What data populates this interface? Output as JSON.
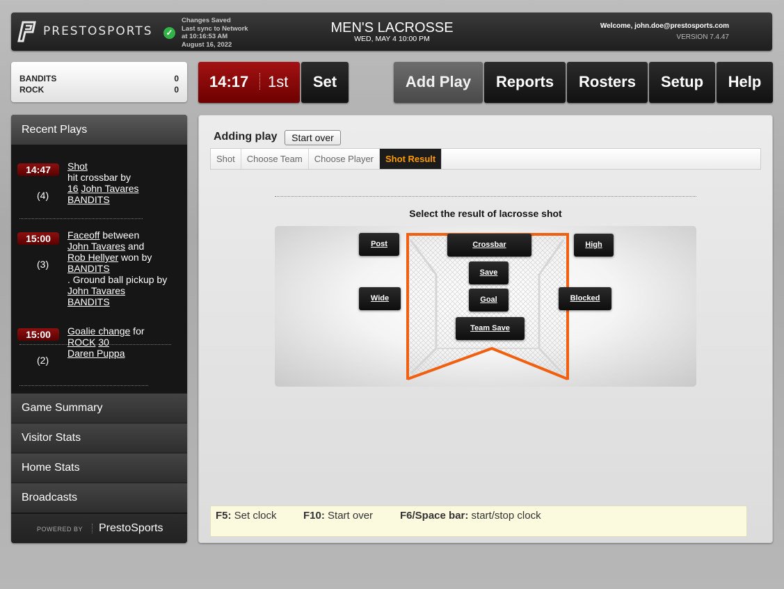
{
  "header": {
    "logo_text": "PRESTOSPORTS",
    "sync": {
      "line1": "Changes Saved",
      "line2": "Last sync to Network",
      "line3": "at 10:16:53 AM",
      "line4": "August 16, 2022"
    },
    "game_title": "MEN'S LACROSSE",
    "game_date": "WED, MAY 4 10:00 PM",
    "welcome": "Welcome, john.doe@prestosports.com",
    "version": "VERSION 7.4.47"
  },
  "scoreboard": {
    "teams": [
      {
        "name": "BANDITS",
        "score": "0"
      },
      {
        "name": "ROCK",
        "score": "0"
      }
    ]
  },
  "clock": {
    "time": "14:17",
    "period": "1st"
  },
  "toolbar": {
    "set_label": "Set",
    "add_play_label": "Add Play",
    "reports_label": "Reports",
    "rosters_label": "Rosters",
    "setup_label": "Setup",
    "help_label": "Help"
  },
  "sidebar": {
    "recent_plays_title": "Recent Plays",
    "plays": [
      {
        "time": "14:47",
        "seq": "(4)",
        "type": "Shot",
        "l2": "hit crossbar  by",
        "num": "16",
        "player": "John Tavares",
        "team": "BANDITS"
      },
      {
        "time": "15:00",
        "seq": "(3)",
        "type": "Faceoff",
        "between": " between",
        "player1": "John Tavares",
        "and": " and",
        "player2": "Rob Hellyer",
        "wonby": " won by",
        "team1": "BANDITS",
        "gb": ". Ground ball pickup by",
        "player3": "John Tavares",
        "team2": "BANDITS"
      },
      {
        "time": "15:00",
        "seq": "(2)",
        "type": "Goalie change",
        "for": " for",
        "team": "ROCK",
        "num": "30",
        "player": "Daren Puppa"
      }
    ],
    "menu": [
      "Game Summary",
      "Visitor Stats",
      "Home Stats",
      "Broadcasts"
    ],
    "powered_by": "POWERED BY",
    "brand": "PrestoSports"
  },
  "main": {
    "adding_label": "Adding play",
    "start_over_label": "Start over",
    "crumbs": [
      "Shot",
      "Choose Team",
      "Choose Player",
      "Shot Result"
    ],
    "prompt": "Select the result of lacrosse shot",
    "results": {
      "post": "Post",
      "crossbar": "Crossbar",
      "high": "High",
      "save": "Save",
      "wide": "Wide",
      "goal": "Goal",
      "blocked": "Blocked",
      "team_save": "Team Save"
    },
    "shortcuts": [
      {
        "key": "F5:",
        "action": "Set clock"
      },
      {
        "key": "F10:",
        "action": "Start over"
      },
      {
        "key": "F6/Space bar:",
        "action": "start/stop clock"
      }
    ]
  },
  "colors": {
    "clock_red": "#a31212",
    "active_crumb_text": "#ff9a00",
    "goal_frame": "#f06010",
    "sync_green": "#33b248"
  }
}
